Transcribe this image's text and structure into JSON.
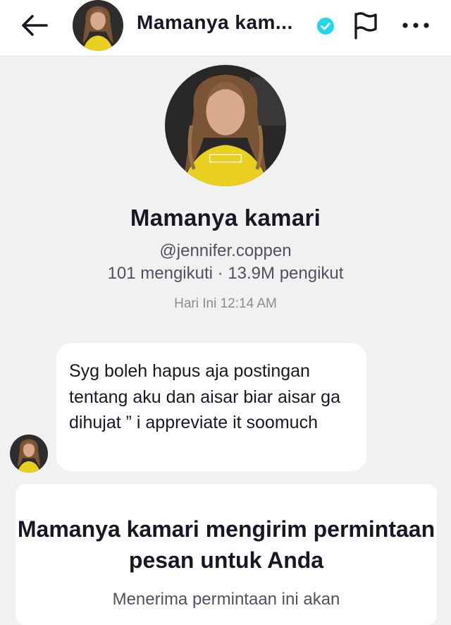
{
  "header": {
    "title": "Mamanya kam...",
    "icons": {
      "back": "arrow-left-icon",
      "verified": "verified-badge-icon",
      "report": "flag-icon",
      "more": "more-horizontal-icon"
    }
  },
  "profile": {
    "name": "Mamanya kamari",
    "handle": "@jennifer.coppen",
    "stats": "101 mengikuti · 13.9M pengikut"
  },
  "conversation": {
    "timestamp": "Hari Ini 12:14 AM",
    "message": "Syg boleh hapus aja postingan tentang aku dan aisar biar aisar ga dihujat ” i appreviate it soomuch"
  },
  "request": {
    "title": "Mamanya kamari mengirim permintaan pesan untuk Anda",
    "subtitle": "Menerima permintaan ini akan"
  },
  "colors": {
    "verified": "#20d5ec",
    "background": "#f1f1f1",
    "text": "#161823",
    "secondary_text": "#505160",
    "shirt_yellow": "#e9cf20"
  }
}
